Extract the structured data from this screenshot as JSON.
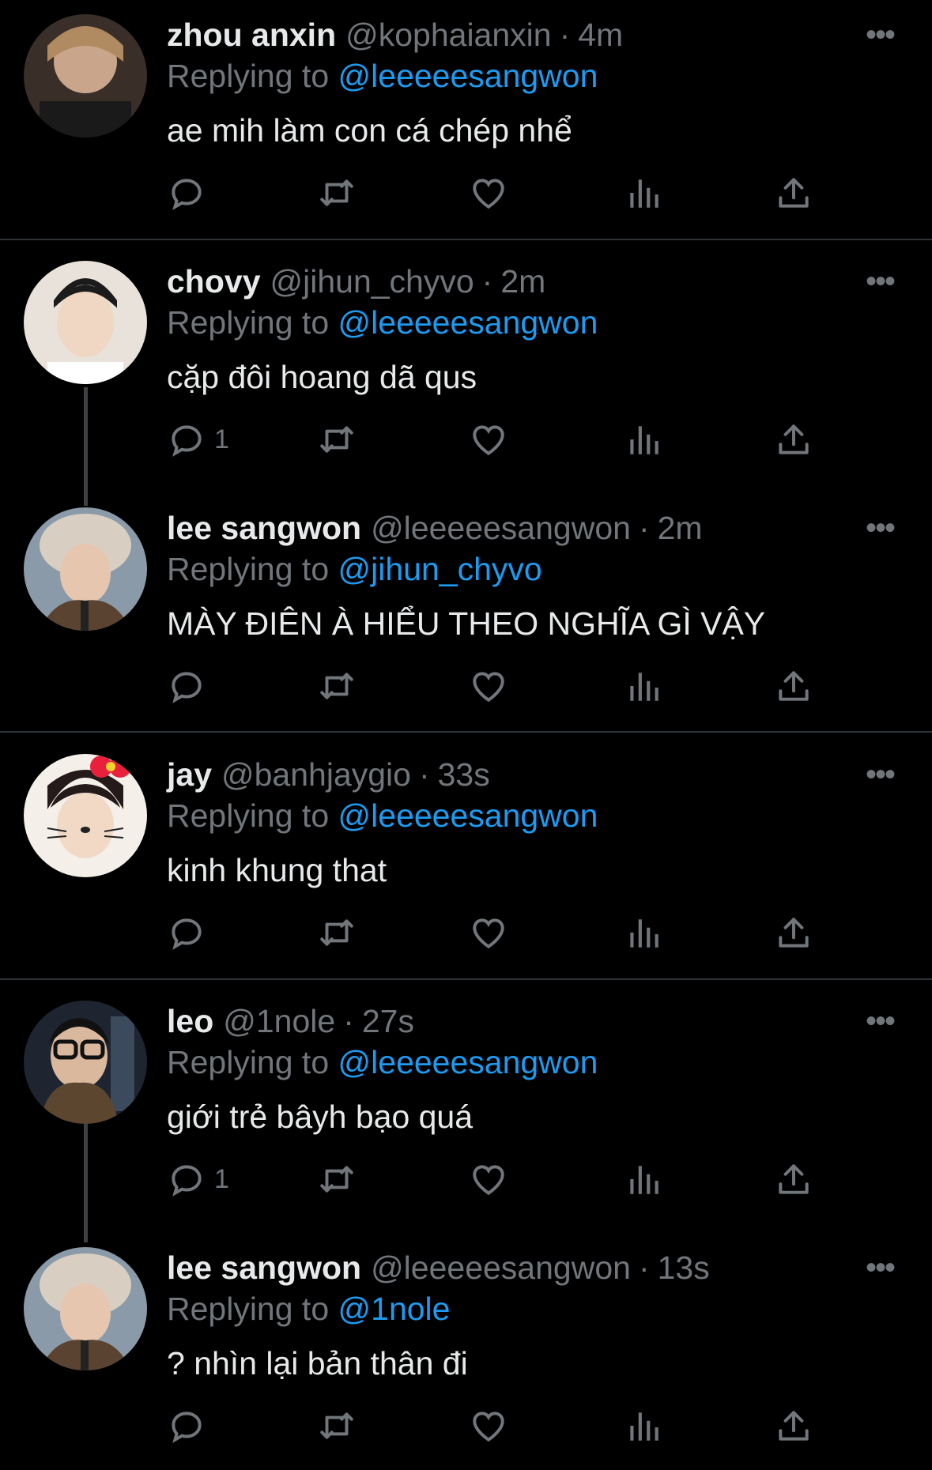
{
  "icons": {
    "reply": "reply-bubble-icon",
    "retweet": "retweet-icon",
    "like": "heart-icon",
    "views": "views-bar-chart-icon",
    "share": "share-upload-icon",
    "more": "more-dots-icon"
  },
  "colors": {
    "link": "#1d9bf0",
    "muted": "#71767b",
    "text": "#e7e9ea",
    "background": "#000000"
  },
  "tweets": [
    {
      "name": "zhou anxin",
      "handle": "@kophaianxin",
      "dot": "·",
      "time": "4m",
      "replying_prefix": "Replying to",
      "replying_to": "@leeeeesangwon",
      "text": "ae mih làm con cá chép nhể",
      "reply_count": "",
      "more": "•••"
    },
    {
      "name": "chovy",
      "handle": "@jihun_chyvo",
      "dot": "·",
      "time": "2m",
      "replying_prefix": "Replying to",
      "replying_to": "@leeeeesangwon",
      "text": "cặp đôi hoang dã qus",
      "reply_count": "1",
      "more": "•••"
    },
    {
      "name": "lee sangwon",
      "handle": "@leeeeesangwon",
      "dot": "·",
      "time": "2m",
      "replying_prefix": "Replying to",
      "replying_to": "@jihun_chyvo",
      "text": "MÀY ĐIÊN À HIỂU THEO NGHĨA GÌ VẬY",
      "reply_count": "",
      "more": "•••"
    },
    {
      "name": "jay",
      "handle": "@banhjaygio",
      "dot": "·",
      "time": "33s",
      "replying_prefix": "Replying to",
      "replying_to": "@leeeeesangwon",
      "text": "kinh khung that",
      "reply_count": "",
      "more": "•••"
    },
    {
      "name": "leo",
      "handle": "@1nole",
      "dot": "·",
      "time": "27s",
      "replying_prefix": "Replying to",
      "replying_to": "@leeeeesangwon",
      "text": "giới trẻ bâyh bạo quá",
      "reply_count": "1",
      "more": "•••"
    },
    {
      "name": "lee sangwon",
      "handle": "@leeeeesangwon",
      "dot": "·",
      "time": "13s",
      "replying_prefix": "Replying to",
      "replying_to": "@1nole",
      "text": "? nhìn lại bản thân đi",
      "reply_count": "",
      "more": "•••"
    }
  ]
}
